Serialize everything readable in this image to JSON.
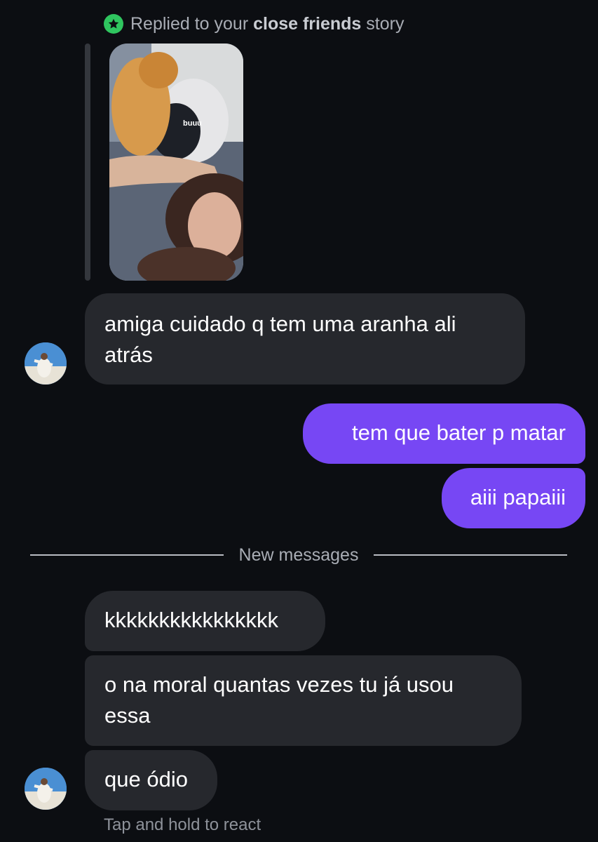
{
  "story_reply": {
    "prefix": "Replied to your ",
    "highlight": "close friends",
    "suffix": " story",
    "story_caption": "buuu"
  },
  "messages": [
    {
      "sender": "them",
      "text": "amiga cuidado q tem uma aranha ali atrás"
    },
    {
      "sender": "me",
      "text": "tem que bater p matar"
    },
    {
      "sender": "me",
      "text": "aiii papaiii"
    },
    {
      "sender": "them",
      "text": "kkkkkkkkkkkkkkkk"
    },
    {
      "sender": "them",
      "text": "o na moral quantas vezes tu já usou essa"
    },
    {
      "sender": "them",
      "text": "que ódio"
    }
  ],
  "divider_label": "New messages",
  "hint_text": "Tap and hold to react",
  "colors": {
    "background": "#0c0e12",
    "incoming_bubble": "#26282d",
    "outgoing_bubble": "#7747f4",
    "close_friends_badge": "#2fc55f"
  },
  "icons": {
    "close_friends": "star-icon"
  }
}
